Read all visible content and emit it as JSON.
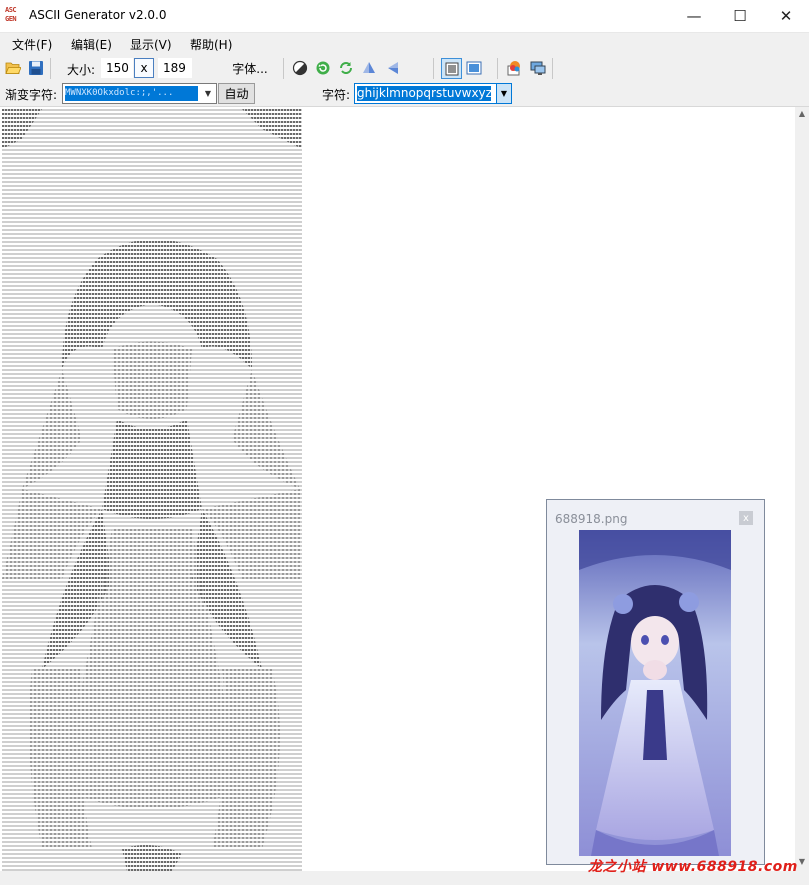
{
  "window": {
    "title": "ASCII Generator v2.0.0",
    "app_icon_text": [
      "ASC",
      "GEN"
    ],
    "minimize_glyph": "—",
    "maximize_glyph": "☐",
    "close_glyph": "✕"
  },
  "menu": [
    {
      "label": "文件(F)"
    },
    {
      "label": "编辑(E)"
    },
    {
      "label": "显示(V)"
    },
    {
      "label": "帮助(H)"
    }
  ],
  "toolbar": {
    "open_icon": "folder-open-icon",
    "save_icon": "save-icon",
    "size_label": "大小:",
    "width": "150",
    "lock_label": "x",
    "height": "189",
    "font_label": "字体...",
    "brightness_icon": "contrast-icon",
    "rotate_icon": "refresh-icon",
    "redo_icon": "cycle-icon",
    "flip_v_icon": "flip-vertical-icon",
    "flip_h_icon": "flip-horizontal-icon",
    "text_view_icon": "text-view-icon",
    "image_view_icon": "image-view-icon",
    "color_icon": "color-palette-icon",
    "display_icon": "monitor-icon"
  },
  "options": {
    "ramp_label": "渐变字符:",
    "ramp_value": "MWNXK0Okxdolc:;,'... ",
    "auto_label": "自动",
    "chars_label": "字符:",
    "chars_value": "ghijklmnopqrstuvwxyz$"
  },
  "preview": {
    "filename": "688918.png",
    "close_glyph": "x"
  },
  "scroll": {
    "up": "▲",
    "down": "▼"
  },
  "watermark": "龙之小站 www.688918.com",
  "colors": {
    "accent": "#0078d7",
    "chrome": "#f0f0f0",
    "watermark": "#e0201a"
  }
}
